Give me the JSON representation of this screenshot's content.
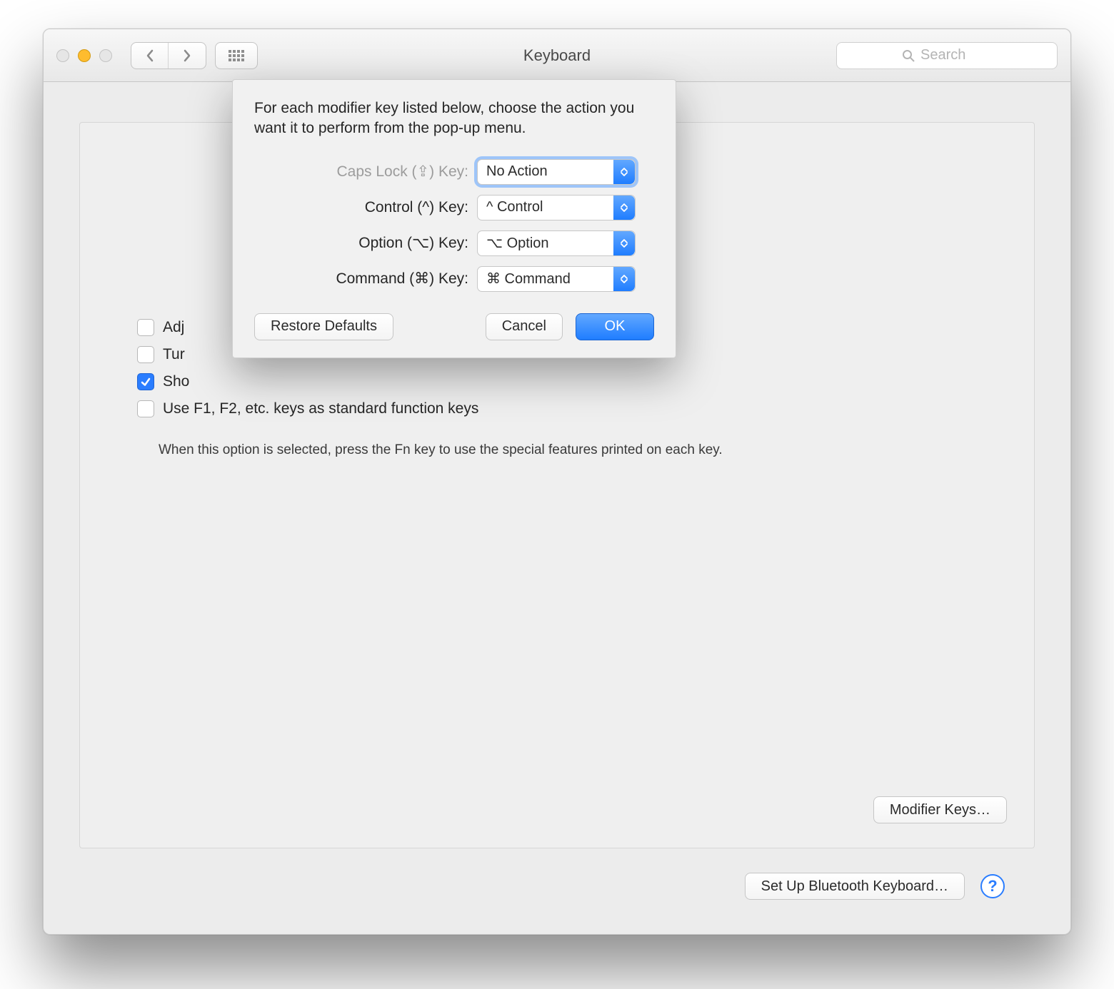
{
  "window": {
    "title": "Keyboard"
  },
  "toolbar": {
    "search_placeholder": "Search"
  },
  "checks": {
    "adjust": "Adj",
    "turn": "Tur",
    "show": "Sho",
    "fkeys": "Use F1, F2, etc. keys as standard function keys",
    "fkeys_hint": "When this option is selected, press the Fn key to use the special features printed on each key."
  },
  "buttons": {
    "modifier": "Modifier Keys…",
    "bluetooth": "Set Up Bluetooth Keyboard…",
    "restore": "Restore Defaults",
    "cancel": "Cancel",
    "ok": "OK"
  },
  "sheet": {
    "description": "For each modifier key listed below, choose the action you want it to perform from the pop-up menu.",
    "rows": [
      {
        "label": "Caps Lock (⇪) Key:",
        "value": "No Action",
        "muted": true,
        "focused": true
      },
      {
        "label": "Control (^) Key:",
        "value": "^ Control",
        "muted": false,
        "focused": false
      },
      {
        "label": "Option (⌥) Key:",
        "value": "⌥ Option",
        "muted": false,
        "focused": false
      },
      {
        "label": "Command (⌘) Key:",
        "value": "⌘ Command",
        "muted": false,
        "focused": false
      }
    ]
  }
}
